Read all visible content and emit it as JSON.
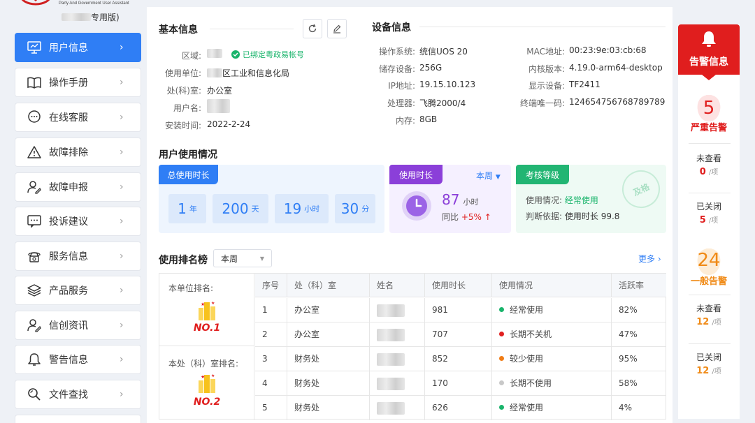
{
  "logo": {
    "subtitle": "Party And Government User Assistant",
    "name_suffix": "专用版)"
  },
  "sidebar": {
    "items": [
      {
        "label": "用户信息",
        "icon": "monitor-icon"
      },
      {
        "label": "操作手册",
        "icon": "book-icon"
      },
      {
        "label": "在线客服",
        "icon": "chat-icon"
      },
      {
        "label": "故障排除",
        "icon": "warning-icon"
      },
      {
        "label": "故障申报",
        "icon": "user-report-icon"
      },
      {
        "label": "投诉建议",
        "icon": "message-icon"
      },
      {
        "label": "服务信息",
        "icon": "phone-icon"
      },
      {
        "label": "产品服务",
        "icon": "layers-icon"
      },
      {
        "label": "信创资讯",
        "icon": "user-news-icon"
      },
      {
        "label": "警告信息",
        "icon": "bell-icon"
      },
      {
        "label": "文件查找",
        "icon": "search-icon"
      }
    ]
  },
  "basic": {
    "title": "基本信息",
    "region_label": "区域:",
    "bound_text": "已绑定粤政易帐号",
    "unit_label": "使用单位:",
    "unit_value": "区工业和信息化局",
    "dept_label": "处(科)室:",
    "dept_value": "办公室",
    "user_label": "用户名:",
    "install_label": "安装时间:",
    "install_value": "2022-2-24"
  },
  "device": {
    "title": "设备信息",
    "os_label": "操作系统:",
    "os_value": "统信UOS 20",
    "storage_label": "储存设备:",
    "storage_value": "256G",
    "ip_label": "IP地址:",
    "ip_value": "19.15.10.123",
    "cpu_label": "处理器:",
    "cpu_value": "飞腾2000/4",
    "mem_label": "内存:",
    "mem_value": "8GB",
    "mac_label": "MAC地址:",
    "mac_value": "00:23:9e:03:cb:68",
    "kernel_label": "内核版本:",
    "kernel_value": "4.19.0-arm64-desktop",
    "display_label": "显示设备:",
    "display_value": "TF2411",
    "term_label": "终端唯一码:",
    "term_value": "124654756768789789"
  },
  "usage": {
    "title": "用户使用情况",
    "total_tag": "总使用时长",
    "total": [
      {
        "num": "1",
        "unit": "年"
      },
      {
        "num": "200",
        "unit": "天"
      },
      {
        "num": "19",
        "unit": "小时"
      },
      {
        "num": "30",
        "unit": "分"
      }
    ],
    "duration_tag": "使用时长",
    "period": "本周",
    "hours": "87",
    "hours_unit": "小时",
    "compare_label": "同比",
    "compare_value": "+5%",
    "grade_tag": "考核等级",
    "usage_label": "使用情况:",
    "usage_value": "经常使用",
    "basis_label": "判断依据:",
    "basis_value": "使用时长 99.8",
    "stamp": "及格"
  },
  "ranking": {
    "title": "使用排名榜",
    "period": "本周",
    "more": "更多",
    "unit_rank_label": "本单位排名:",
    "unit_rank": "NO.1",
    "dept_rank_label": "本处（科）室排名:",
    "dept_rank": "NO.2",
    "headers": [
      "序号",
      "处（科）室",
      "姓名",
      "使用时长",
      "使用情况",
      "活跃率"
    ],
    "rows": [
      {
        "idx": "1",
        "dept": "办公室",
        "dur": "981",
        "status": "经常使用",
        "color": "#19b46b",
        "rate": "82%"
      },
      {
        "idx": "2",
        "dept": "办公室",
        "dur": "707",
        "status": "长期不关机",
        "color": "#e02020",
        "rate": "47%"
      },
      {
        "idx": "3",
        "dept": "财务处",
        "dur": "852",
        "status": "较少使用",
        "color": "#f07c16",
        "rate": "95%"
      },
      {
        "idx": "4",
        "dept": "财务处",
        "dur": "170",
        "status": "长期不使用",
        "color": "#c8c8c8",
        "rate": "58%"
      },
      {
        "idx": "5",
        "dept": "财务处",
        "dur": "626",
        "status": "经常使用",
        "color": "#19b46b",
        "rate": "4%"
      }
    ]
  },
  "alerts": {
    "title": "告警信息",
    "severe_count": "5",
    "severe_label": "严重告警",
    "severe_unread_label": "未查看",
    "severe_unread": "0",
    "severe_closed_label": "已关闭",
    "severe_closed": "5",
    "general_count": "24",
    "general_label": "一般告警",
    "general_unread_label": "未查看",
    "general_unread": "12",
    "general_closed_label": "已关闭",
    "general_closed": "12",
    "unit": "/项"
  }
}
